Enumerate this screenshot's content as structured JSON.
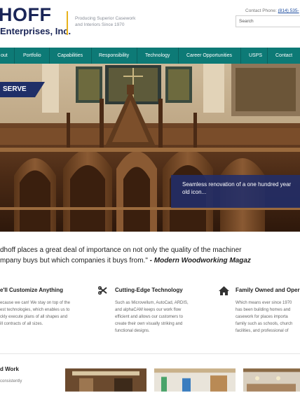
{
  "header": {
    "logo_top": "HOFF",
    "logo_bottom": "Enterprises, Inc.",
    "tagline_line1": "Producing Superior Casework",
    "tagline_line2": "and Interiors Since 1970",
    "contact_label": "Contact Phone:",
    "contact_phone": "(814) 535-",
    "search_placeholder": "Search"
  },
  "nav": {
    "items": [
      "out",
      "Portfolio",
      "Capabilities",
      "Responsibility",
      "Technology",
      "Career Opportunities",
      "USPS",
      "Contact"
    ]
  },
  "hero": {
    "banner": "SERVE",
    "caption": "Seamless renovation of a one hundred year old icon..."
  },
  "quote": {
    "line1": "dhoff places a great deal of importance on not only the quality of the machiner",
    "line2_plain": "mpany buys but which companies it buys from.\"",
    "line2_emph": " - Modern Woodworking Magaz"
  },
  "features": [
    {
      "icon": "customize-icon",
      "title": "e'll Customize Anything",
      "lines": [
        "ecause we can! We stay on top of the",
        "est technologies, which enables us to",
        "ckly execute plans of all shapes and",
        "ill contracts of all sizes."
      ]
    },
    {
      "icon": "tools-icon",
      "title": "Cutting-Edge Technology",
      "lines": [
        "Such as Microvellum, AutoCad, ARDIS,",
        "and alphaCAM keeps our work flow",
        "efficient and allows our customers to",
        "create their own visually striking and",
        "functional designs."
      ]
    },
    {
      "icon": "home-icon",
      "title": "Family Owned and Oper",
      "lines": [
        "Which means ever since 1970",
        "has been building homes and",
        "casework for places importa",
        "family such as schools, church",
        "facilities, and professional of"
      ]
    }
  ],
  "work": {
    "title": "d Work",
    "body": "consistently"
  },
  "colors": {
    "brand_navy": "#1a2557",
    "nav_teal": "#0d7a76",
    "accent_gold": "#e8b21c",
    "caption_blue": "#212e6a"
  }
}
